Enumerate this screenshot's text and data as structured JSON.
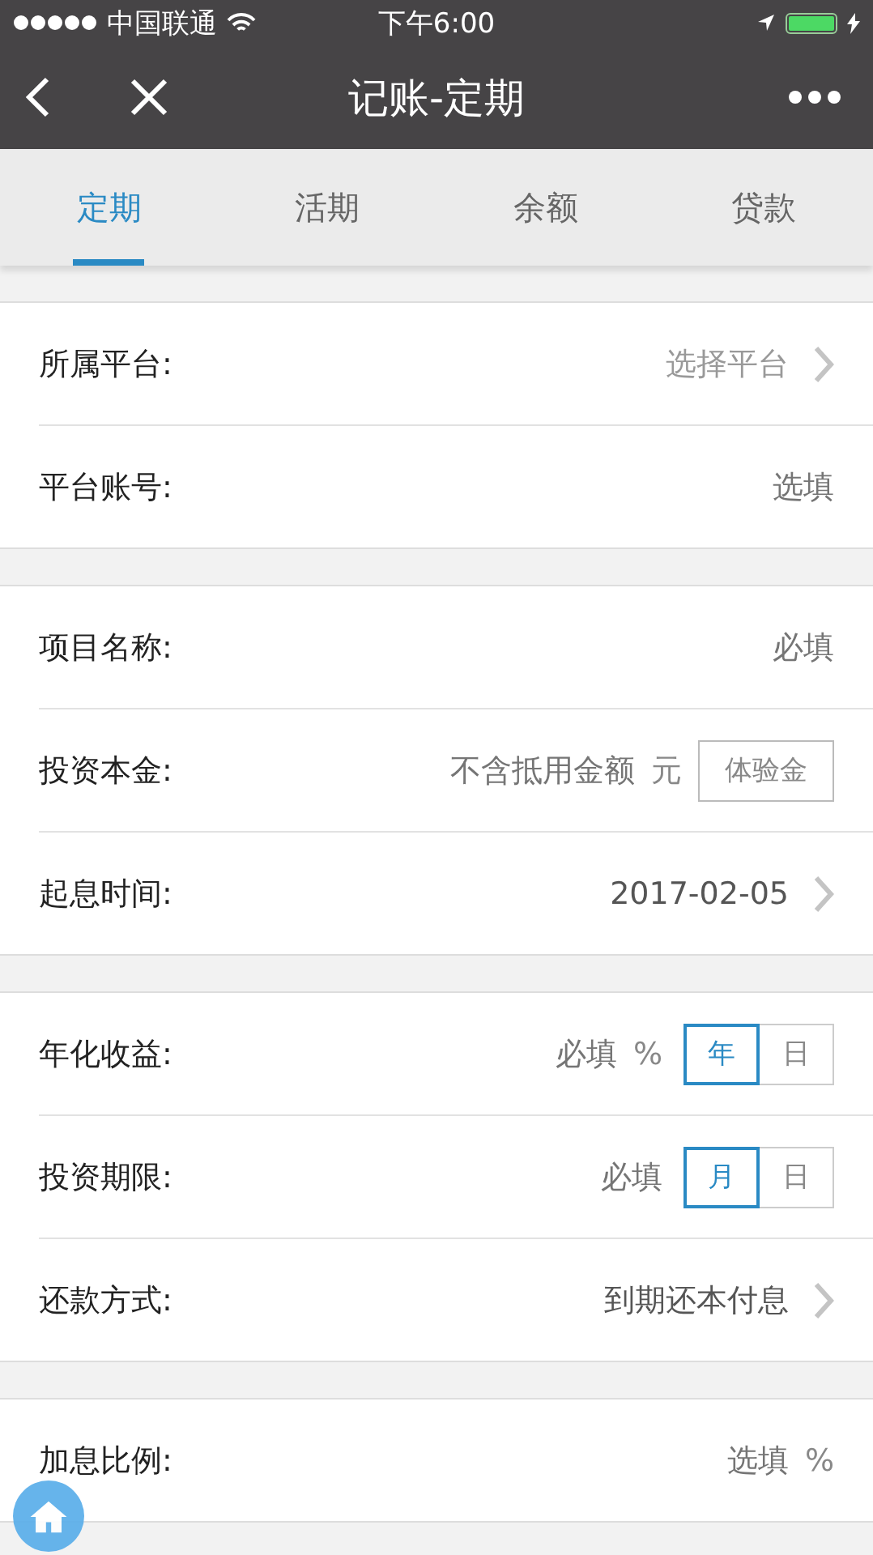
{
  "status_bar": {
    "carrier": "中国联通",
    "time": "下午6:00"
  },
  "nav_bar": {
    "title": "记账-定期"
  },
  "tabs": [
    {
      "label": "定期",
      "selected": true
    },
    {
      "label": "活期",
      "selected": false
    },
    {
      "label": "余额",
      "selected": false
    },
    {
      "label": "贷款",
      "selected": false
    }
  ],
  "sections": [
    {
      "rows": [
        {
          "label": "所属平台:",
          "kind": "picker",
          "placeholder": "选择平台"
        },
        {
          "label": "平台账号:",
          "kind": "input",
          "placeholder": "选填"
        }
      ]
    },
    {
      "rows": [
        {
          "label": "项目名称:",
          "kind": "input",
          "placeholder": "必填"
        },
        {
          "label": "投资本金:",
          "kind": "input",
          "placeholder": "不含抵用金额",
          "unit": "元",
          "toggle": {
            "label": "体验金",
            "on": false
          }
        },
        {
          "label": "起息时间:",
          "kind": "picker",
          "value": "2017-02-05"
        }
      ]
    },
    {
      "rows": [
        {
          "label": "年化收益:",
          "kind": "input",
          "placeholder": "必填",
          "unit": "%",
          "options": [
            {
              "label": "年",
              "selected": true
            },
            {
              "label": "日",
              "selected": false
            }
          ]
        },
        {
          "label": "投资期限:",
          "kind": "input",
          "placeholder": "必填",
          "options": [
            {
              "label": "月",
              "selected": true
            },
            {
              "label": "日",
              "selected": false
            }
          ]
        },
        {
          "label": "还款方式:",
          "kind": "picker",
          "value": "到期还本付息"
        }
      ]
    },
    {
      "rows": [
        {
          "label": "加息比例:",
          "kind": "input",
          "placeholder": "选填",
          "unit": "%"
        }
      ]
    }
  ],
  "home_button": {
    "kind": "floating"
  }
}
